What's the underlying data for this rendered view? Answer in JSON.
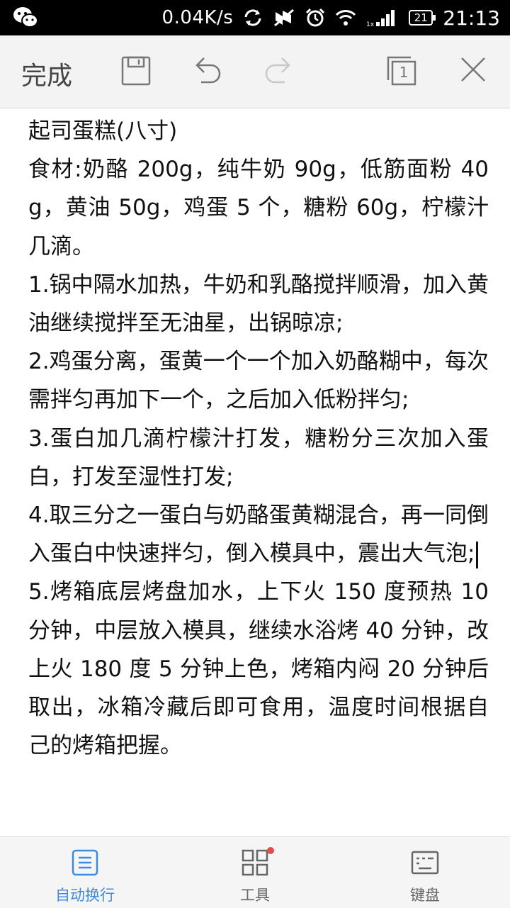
{
  "status_bar": {
    "network_speed": "0.04K/s",
    "battery": "21",
    "time": "21:13",
    "icons": [
      "wechat-icon",
      "sync-icon",
      "mute-icon",
      "alarm-icon",
      "wifi-icon",
      "signal-icon",
      "battery-icon"
    ]
  },
  "toolbar": {
    "done_label": "完成",
    "page_number": "1",
    "icons": [
      "save-icon",
      "undo-icon",
      "redo-icon",
      "pages-icon",
      "close-icon"
    ]
  },
  "document": {
    "paragraphs": [
      "起司蛋糕(八寸)",
      "食材:奶酪 200g，纯牛奶 90g，低筋面粉 40g，黄油 50g，鸡蛋 5 个，糖粉 60g，柠檬汁几滴。",
      "1.锅中隔水加热，牛奶和乳酪搅拌顺滑，加入黄油继续搅拌至无油星，出锅晾凉;",
      "2.鸡蛋分离，蛋黄一个一个加入奶酪糊中，每次需拌匀再加下一个，之后加入低粉拌匀;",
      "3.蛋白加几滴柠檬汁打发，糖粉分三次加入蛋白，打发至湿性打发;",
      "4.取三分之一蛋白与奶酪蛋黄糊混合，再一同倒入蛋白中快速拌匀，倒入模具中，震出大气泡;",
      "5.烤箱底层烤盘加水，上下火 150 度预热 10 分钟，中层放入模具，继续水浴烤 40 分钟，改上火 180 度 5 分钟上色，烤箱内闷 20 分钟后取出，冰箱冷藏后即可食用，温度时间根据自己的烤箱把握。"
    ]
  },
  "bottom_nav": {
    "items": [
      {
        "label": "自动换行",
        "icon": "wrap-icon",
        "active": true
      },
      {
        "label": "工具",
        "icon": "tools-icon",
        "active": false,
        "badge": true
      },
      {
        "label": "键盘",
        "icon": "keyboard-icon",
        "active": false
      }
    ]
  },
  "colors": {
    "accent": "#3b8be0",
    "badge": "#e84a4a",
    "toolbar_bg": "#f3f3f3",
    "text": "#111111"
  }
}
